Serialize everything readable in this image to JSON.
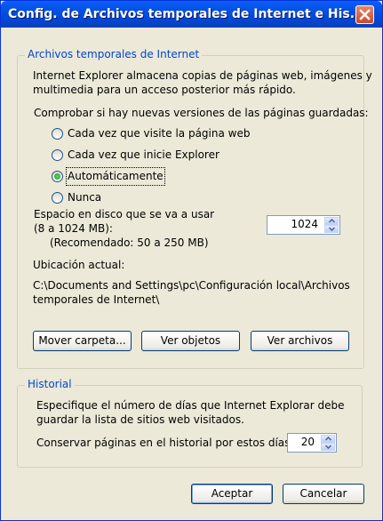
{
  "window": {
    "title": "Config. de Archivos temporales de Internet e His..."
  },
  "temp_files": {
    "legend": "Archivos temporales de Internet",
    "description_line1": "Internet Explorer almacena copias de páginas web, imágenes y",
    "description_line2": "multimedia para un acceso posterior más rápido.",
    "check_label": "Comprobar si hay nuevas versiones de las páginas guardadas:",
    "options": [
      {
        "label": "Cada vez que visite la página web",
        "selected": false
      },
      {
        "label": "Cada vez que inicie Explorer",
        "selected": false
      },
      {
        "label": "Automáticamente",
        "selected": true
      },
      {
        "label": "Nunca",
        "selected": false
      }
    ],
    "space_line1": "Espacio en disco que se va a usar",
    "space_line2": "(8 a 1024 MB):",
    "space_recommended": "(Recomendado: 50 a 250 MB)",
    "space_value": "1024",
    "location_label": "Ubicación actual:",
    "location_line1": "C:\\Documents and Settings\\pc\\Configuración local\\Archivos",
    "location_line2": "temporales de Internet\\",
    "buttons": {
      "move_folder": "Mover carpeta...",
      "view_objects": "Ver objetos",
      "view_files": "Ver archivos"
    }
  },
  "history": {
    "legend": "Historial",
    "description_line1": "Especifique el número de días que Internet Explorar debe",
    "description_line2": "guardar la lista de sitios web visitados.",
    "days_label": "Conservar páginas en el historial por estos días:",
    "days_value": "20"
  },
  "footer": {
    "accept": "Aceptar",
    "cancel": "Cancelar"
  },
  "colors": {
    "titlebar": "#0553e6",
    "legend": "#0046d5",
    "dialog_bg": "#ece9d8",
    "close_button": "#c94a2a"
  },
  "icons": {
    "close": "close-icon",
    "spin_up": "chevron-up-icon",
    "spin_down": "chevron-down-icon"
  }
}
